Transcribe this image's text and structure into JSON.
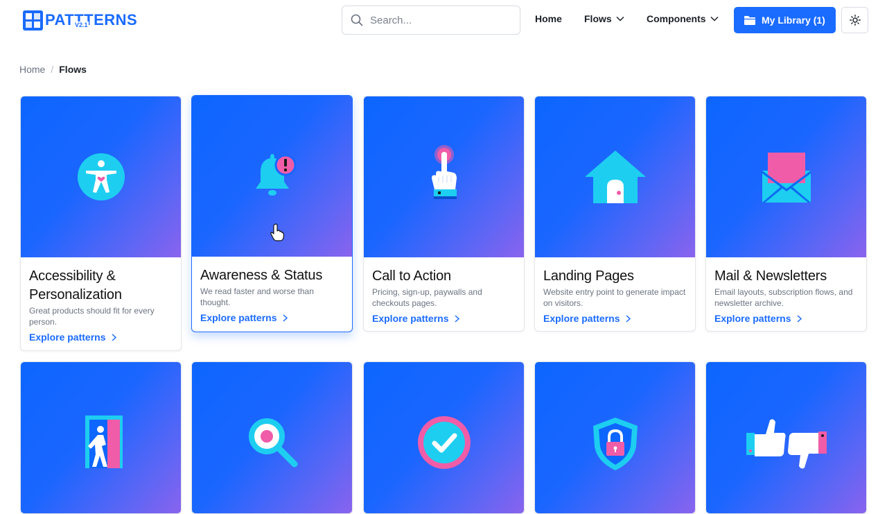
{
  "brand": {
    "logo_text": "PATTTERNS",
    "version": "V2.1"
  },
  "search": {
    "placeholder": "Search..."
  },
  "nav": {
    "home": "Home",
    "flows": "Flows",
    "components": "Components",
    "library": "My Library (1)"
  },
  "breadcrumb": {
    "home": "Home",
    "separator": "/",
    "current": "Flows"
  },
  "colors": {
    "accent": "#1a6bff",
    "pink": "#f05ca8",
    "cyan": "#1ecef0"
  },
  "cards": [
    {
      "title": "Accessibility & Personalization",
      "desc": "Great products should fit for every person.",
      "link": "Explore patterns",
      "icon": "accessibility-icon"
    },
    {
      "title": "Awareness & Status",
      "desc": "We read faster and worse than thought.",
      "link": "Explore patterns",
      "icon": "bell-alert-icon"
    },
    {
      "title": "Call to Action",
      "desc": "Pricing, sign-up, paywalls and checkouts pages.",
      "link": "Explore patterns",
      "icon": "hand-press-icon"
    },
    {
      "title": "Landing Pages",
      "desc": "Website entry point to generate impact on visitors.",
      "link": "Explore patterns",
      "icon": "house-icon"
    },
    {
      "title": "Mail & Newsletters",
      "desc": "Email layouts, subscription flows, and newsletter archive.",
      "link": "Explore patterns",
      "icon": "envelope-icon"
    }
  ],
  "row2_icons": [
    "exit-door-icon",
    "magnifier-icon",
    "checkmark-circle-icon",
    "shield-lock-icon",
    "thumbs-feedback-icon"
  ]
}
